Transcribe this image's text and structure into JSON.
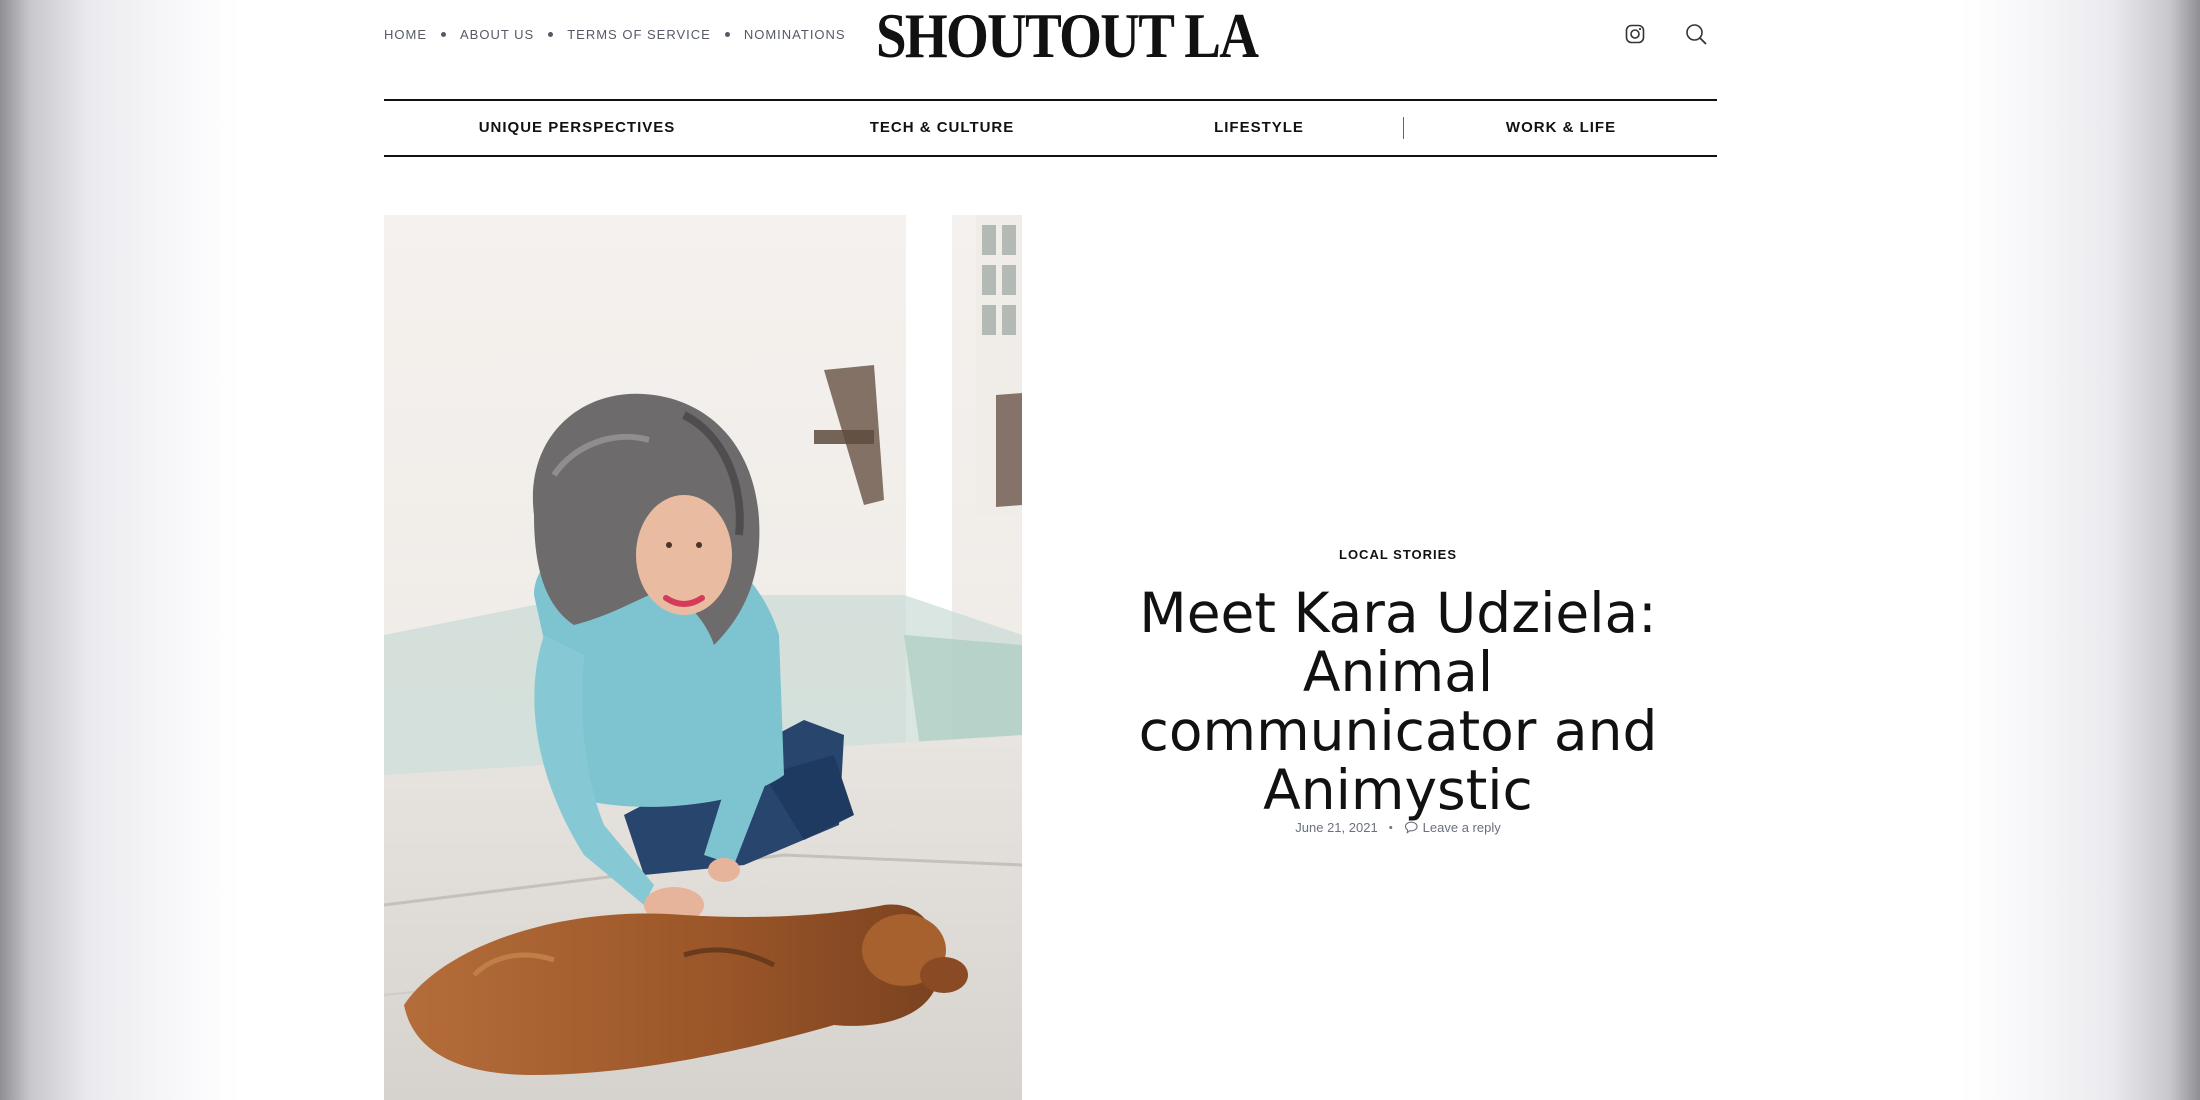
{
  "top_nav": {
    "items": [
      {
        "label": "HOME"
      },
      {
        "label": "ABOUT US"
      },
      {
        "label": "TERMS OF SERVICE"
      },
      {
        "label": "NOMINATIONS"
      }
    ]
  },
  "logo": {
    "text": "SHOUTOUT LA"
  },
  "header_icons": {
    "instagram": "instagram-icon",
    "search": "search-icon"
  },
  "categories": [
    {
      "label": "UNIQUE PERSPECTIVES"
    },
    {
      "label": "TECH & CULTURE"
    },
    {
      "label": "LIFESTYLE"
    },
    {
      "label": "WORK & LIFE"
    }
  ],
  "article": {
    "category": "LOCAL STORIES",
    "title": "Meet Kara Udziela: Animal communicator and Animystic",
    "date": "June 21, 2021",
    "reply_label": "Leave a reply",
    "reply_icon": "comment-icon"
  },
  "colors": {
    "text": "#111111",
    "muted": "#6b7080",
    "top_nav": "#555a66"
  }
}
